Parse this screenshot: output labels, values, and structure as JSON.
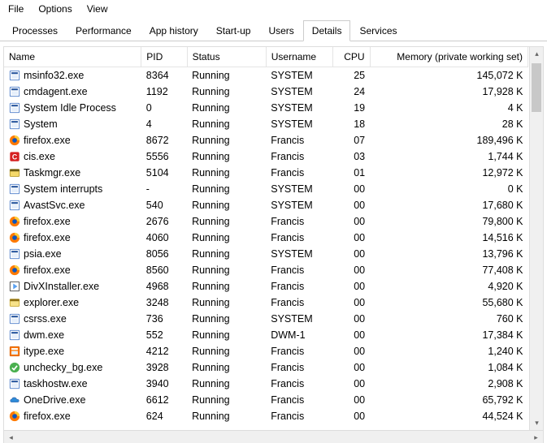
{
  "menu": {
    "items": [
      "File",
      "Options",
      "View"
    ]
  },
  "tabs": {
    "items": [
      "Processes",
      "Performance",
      "App history",
      "Start-up",
      "Users",
      "Details",
      "Services"
    ],
    "activeIndex": 5
  },
  "columns": {
    "name": "Name",
    "pid": "PID",
    "status": "Status",
    "username": "Username",
    "cpu": "CPU",
    "memory": "Memory (private working set)"
  },
  "icons": {
    "sysblue": {
      "bg": "#ffffff",
      "border": "#4a7bc8",
      "accent": "#2d5aa0"
    },
    "cmd": {
      "bg": "#ffffff",
      "border": "#4a7bc8",
      "accent": "#2d5aa0"
    },
    "firefox": {
      "bg": "#ff7a00",
      "border": "#d85f00",
      "accent": "#0a57c2"
    },
    "comodo": {
      "bg": "#d62020",
      "border": "#a51010",
      "accent": "#ffffff"
    },
    "task": {
      "bg": "#f5d96a",
      "border": "#b89b2a",
      "accent": "#6b5a12"
    },
    "avast": {
      "bg": "#ffffff",
      "border": "#4a7bc8",
      "accent": "#2d5aa0"
    },
    "divx": {
      "bg": "#ffffff",
      "border": "#404040",
      "accent": "#5aa0f0"
    },
    "explorer": {
      "bg": "#f7e28a",
      "border": "#c8a830",
      "accent": "#8d6f15"
    },
    "dwm": {
      "bg": "#ffffff",
      "border": "#4a7bc8",
      "accent": "#2d5aa0"
    },
    "itype": {
      "bg": "#ff7a00",
      "border": "#d85f00",
      "accent": "#ffffff"
    },
    "unchecky": {
      "bg": "#4bb050",
      "border": "#2e7a33",
      "accent": "#ffffff"
    },
    "onedrive": {
      "bg": "#ffffff",
      "border": "#2d5aa0",
      "accent": "#2e8bd8"
    }
  },
  "rows": [
    {
      "icon": "sysblue",
      "name": "msinfo32.exe",
      "pid": "8364",
      "status": "Running",
      "user": "SYSTEM",
      "cpu": "25",
      "mem": "145,072 K"
    },
    {
      "icon": "cmd",
      "name": "cmdagent.exe",
      "pid": "1192",
      "status": "Running",
      "user": "SYSTEM",
      "cpu": "24",
      "mem": "17,928 K"
    },
    {
      "icon": "sysblue",
      "name": "System Idle Process",
      "pid": "0",
      "status": "Running",
      "user": "SYSTEM",
      "cpu": "19",
      "mem": "4 K"
    },
    {
      "icon": "sysblue",
      "name": "System",
      "pid": "4",
      "status": "Running",
      "user": "SYSTEM",
      "cpu": "18",
      "mem": "28 K"
    },
    {
      "icon": "firefox",
      "name": "firefox.exe",
      "pid": "8672",
      "status": "Running",
      "user": "Francis",
      "cpu": "07",
      "mem": "189,496 K"
    },
    {
      "icon": "comodo",
      "name": "cis.exe",
      "pid": "5556",
      "status": "Running",
      "user": "Francis",
      "cpu": "03",
      "mem": "1,744 K"
    },
    {
      "icon": "task",
      "name": "Taskmgr.exe",
      "pid": "5104",
      "status": "Running",
      "user": "Francis",
      "cpu": "01",
      "mem": "12,972 K"
    },
    {
      "icon": "sysblue",
      "name": "System interrupts",
      "pid": "-",
      "status": "Running",
      "user": "SYSTEM",
      "cpu": "00",
      "mem": "0 K"
    },
    {
      "icon": "avast",
      "name": "AvastSvc.exe",
      "pid": "540",
      "status": "Running",
      "user": "SYSTEM",
      "cpu": "00",
      "mem": "17,680 K"
    },
    {
      "icon": "firefox",
      "name": "firefox.exe",
      "pid": "2676",
      "status": "Running",
      "user": "Francis",
      "cpu": "00",
      "mem": "79,800 K"
    },
    {
      "icon": "firefox",
      "name": "firefox.exe",
      "pid": "4060",
      "status": "Running",
      "user": "Francis",
      "cpu": "00",
      "mem": "14,516 K"
    },
    {
      "icon": "sysblue",
      "name": "psia.exe",
      "pid": "8056",
      "status": "Running",
      "user": "SYSTEM",
      "cpu": "00",
      "mem": "13,796 K"
    },
    {
      "icon": "firefox",
      "name": "firefox.exe",
      "pid": "8560",
      "status": "Running",
      "user": "Francis",
      "cpu": "00",
      "mem": "77,408 K"
    },
    {
      "icon": "divx",
      "name": "DivXInstaller.exe",
      "pid": "4968",
      "status": "Running",
      "user": "Francis",
      "cpu": "00",
      "mem": "4,920 K"
    },
    {
      "icon": "explorer",
      "name": "explorer.exe",
      "pid": "3248",
      "status": "Running",
      "user": "Francis",
      "cpu": "00",
      "mem": "55,680 K"
    },
    {
      "icon": "sysblue",
      "name": "csrss.exe",
      "pid": "736",
      "status": "Running",
      "user": "SYSTEM",
      "cpu": "00",
      "mem": "760 K"
    },
    {
      "icon": "dwm",
      "name": "dwm.exe",
      "pid": "552",
      "status": "Running",
      "user": "DWM-1",
      "cpu": "00",
      "mem": "17,384 K"
    },
    {
      "icon": "itype",
      "name": "itype.exe",
      "pid": "4212",
      "status": "Running",
      "user": "Francis",
      "cpu": "00",
      "mem": "1,240 K"
    },
    {
      "icon": "unchecky",
      "name": "unchecky_bg.exe",
      "pid": "3928",
      "status": "Running",
      "user": "Francis",
      "cpu": "00",
      "mem": "1,084 K"
    },
    {
      "icon": "sysblue",
      "name": "taskhostw.exe",
      "pid": "3940",
      "status": "Running",
      "user": "Francis",
      "cpu": "00",
      "mem": "2,908 K"
    },
    {
      "icon": "onedrive",
      "name": "OneDrive.exe",
      "pid": "6612",
      "status": "Running",
      "user": "Francis",
      "cpu": "00",
      "mem": "65,792 K"
    },
    {
      "icon": "firefox",
      "name": "firefox.exe",
      "pid": "624",
      "status": "Running",
      "user": "Francis",
      "cpu": "00",
      "mem": "44,524 K"
    }
  ]
}
